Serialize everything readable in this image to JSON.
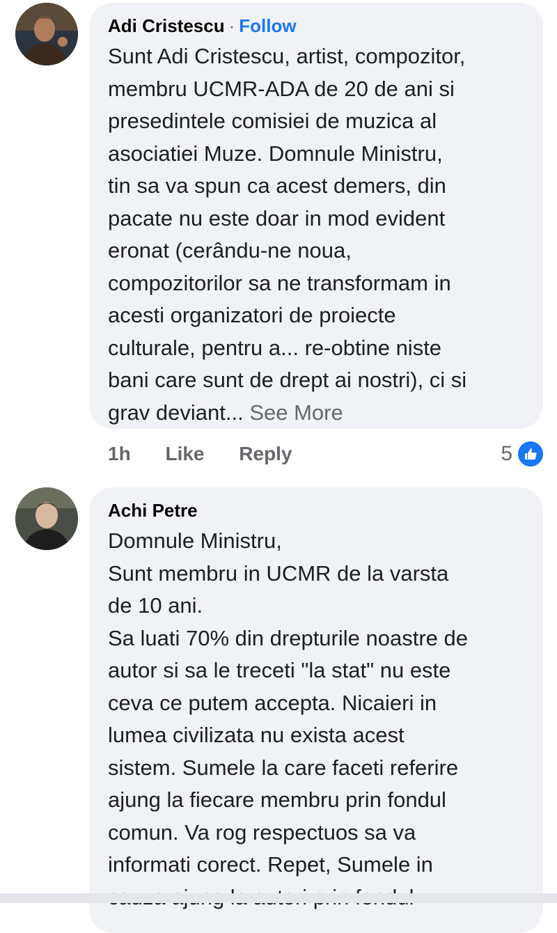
{
  "comments": [
    {
      "author": "Adi Cristescu",
      "separator": "·",
      "follow_label": "Follow",
      "text": "Sunt Adi Cristescu, artist, compozitor,\nmembru UCMR-ADA de 20 de ani si\npresedintele comisiei de muzica al\nasociatiei Muze. Domnule Ministru,\ntin sa va spun ca acest demers, din\npacate nu este doar in mod evident\neronat (cerându-ne noua,\ncompozitorilor sa ne transformam in\nacesti organizatori de proiecte\nculturale, pentru a... re-obtine niste\nbani care sunt de drept ai nostri), ci si\ngrav deviant...",
      "see_more": " See More",
      "time": "1h",
      "like_label": "Like",
      "reply_label": "Reply",
      "reaction_count": "5",
      "reaction_icon": "like-icon",
      "avatar_icon": "person-avatar-icon"
    },
    {
      "author": "Achi Petre",
      "text": "Domnule Ministru,\nSunt membru in UCMR de la varsta\nde 10 ani.\nSa luati 70% din drepturile noastre de\nautor si sa le treceti \"la stat\" nu este\nceva ce putem accepta. Nicaieri in\nlumea civilizata nu exista acest\nsistem. Sumele la care faceti referire\najung la fiecare membru prin fondul\ncomun. Va rog respectuos sa va\ninformati corect. Repet, Sumele in\ncauza ajung la autori prin fondul",
      "avatar_icon": "person-avatar-icon"
    }
  ],
  "colors": {
    "bubble": "#f0f2f5",
    "link": "#1877f2",
    "secondary_text": "#65676b"
  }
}
